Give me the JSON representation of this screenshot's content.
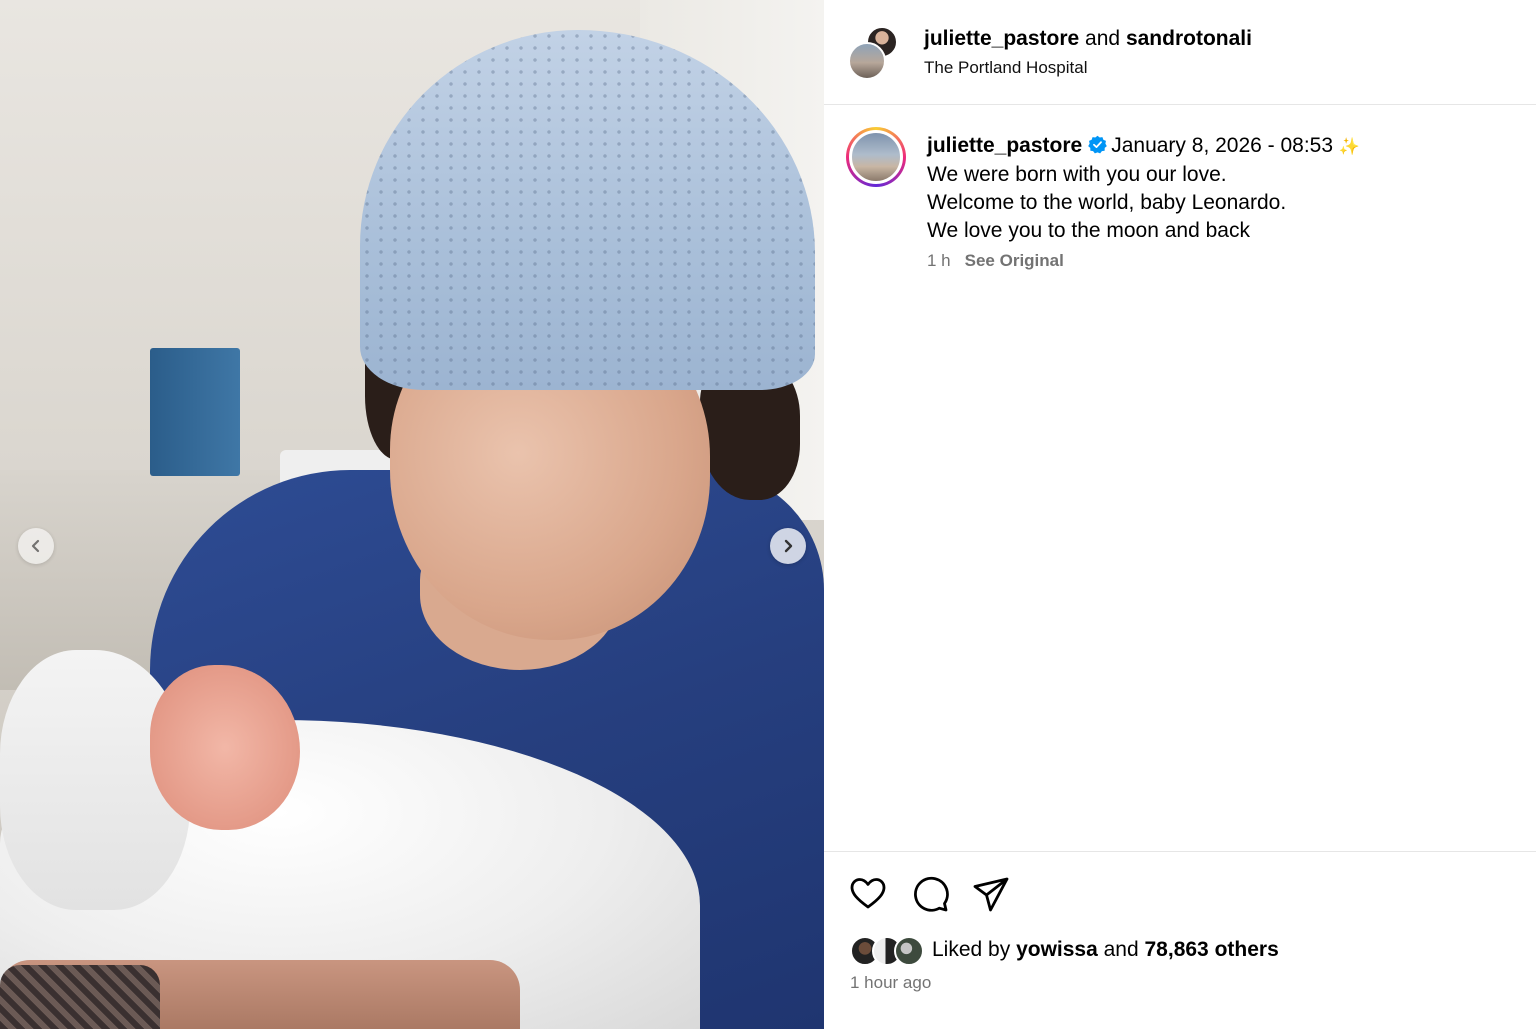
{
  "header": {
    "user1": "juliette_pastore",
    "connector": " and ",
    "user2": "sandrotonali",
    "location": "The Portland Hospital"
  },
  "caption": {
    "username": "juliette_pastore",
    "datetime": "January 8, 2026 - 08:53",
    "sparkle": "✨",
    "lines": [
      "We were born with you our love.",
      "Welcome to the world, baby Leonardo.",
      "We love you to the moon and back"
    ],
    "age": "1 h",
    "see_original": "See Original"
  },
  "likes": {
    "prefix": "Liked by ",
    "user": "yowissa",
    "middle": " and ",
    "others": "78,863 others",
    "time_ago": "1 hour ago"
  },
  "icons": {
    "like": "heart-icon",
    "comment": "comment-icon",
    "share": "share-icon",
    "verified": "verified-badge-icon",
    "prev": "chevron-left-icon",
    "next": "chevron-right-icon"
  },
  "colors": {
    "verified": "#0095f6",
    "meta_gray": "#737373",
    "divider": "#e6e6e6"
  }
}
